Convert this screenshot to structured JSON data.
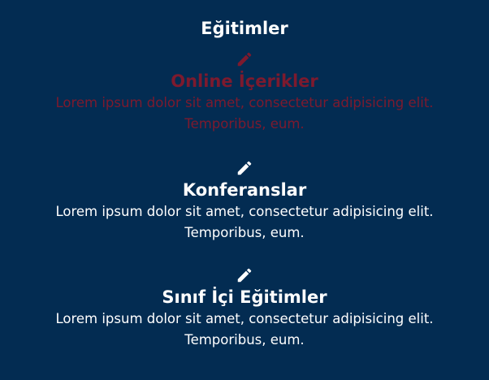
{
  "section": {
    "title": "Eğitimler"
  },
  "colors": {
    "background": "#032c52",
    "text": "#ffffff",
    "active_accent": "#7d1a2e"
  },
  "items": [
    {
      "icon": "pencil-icon",
      "title": "Online İçerikler",
      "description": "Lorem ipsum dolor sit amet, consectetur adipisicing elit. Temporibus, eum.",
      "active": true
    },
    {
      "icon": "pencil-icon",
      "title": "Konferanslar",
      "description": "Lorem ipsum dolor sit amet, consectetur adipisicing elit. Temporibus, eum.",
      "active": false
    },
    {
      "icon": "pencil-icon",
      "title": "Sınıf İçi Eğitimler",
      "description": "Lorem ipsum dolor sit amet, consectetur adipisicing elit. Temporibus, eum.",
      "active": false
    }
  ]
}
